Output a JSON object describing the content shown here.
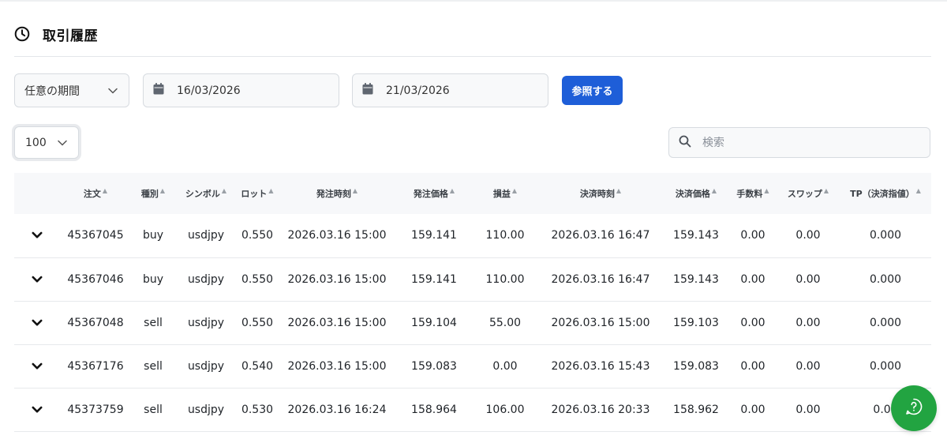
{
  "header": {
    "title": "取引履歴",
    "icon": "clock-icon"
  },
  "filters": {
    "period_label": "任意の期間",
    "start_date": "16/03/2026",
    "end_date": "21/03/2026",
    "query_button": "参照する"
  },
  "page_size": "100",
  "search": {
    "placeholder": "検索"
  },
  "table": {
    "columns": [
      "",
      "注文",
      "種別",
      "シンボル",
      "ロット",
      "発注時刻",
      "発注価格",
      "損益",
      "決済時刻",
      "決済価格",
      "手数料",
      "スワップ",
      "TP（決済指値）"
    ],
    "rows": [
      [
        "45367045",
        "buy",
        "usdjpy",
        "0.550",
        "2026.03.16 15:00",
        "159.141",
        "110.00",
        "2026.03.16 16:47",
        "159.143",
        "0.00",
        "0.00",
        "0.000"
      ],
      [
        "45367046",
        "buy",
        "usdjpy",
        "0.550",
        "2026.03.16 15:00",
        "159.141",
        "110.00",
        "2026.03.16 16:47",
        "159.143",
        "0.00",
        "0.00",
        "0.000"
      ],
      [
        "45367048",
        "sell",
        "usdjpy",
        "0.550",
        "2026.03.16 15:00",
        "159.104",
        "55.00",
        "2026.03.16 15:00",
        "159.103",
        "0.00",
        "0.00",
        "0.000"
      ],
      [
        "45367176",
        "sell",
        "usdjpy",
        "0.540",
        "2026.03.16 15:00",
        "159.083",
        "0.00",
        "2026.03.16 15:43",
        "159.083",
        "0.00",
        "0.00",
        "0.000"
      ],
      [
        "45373759",
        "sell",
        "usdjpy",
        "0.530",
        "2026.03.16 16:24",
        "158.964",
        "106.00",
        "2026.03.16 20:33",
        "158.962",
        "0.00",
        "0.00",
        "0.00"
      ]
    ]
  },
  "colors": {
    "primary": "#1e5ed8",
    "help_button": "#22a441"
  }
}
